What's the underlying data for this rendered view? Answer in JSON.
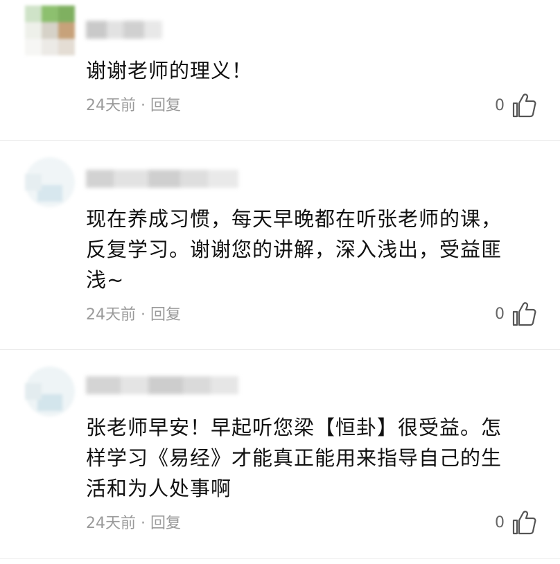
{
  "comments": [
    {
      "text": "谢谢老师的理义！",
      "time": "24天前",
      "separator": " · ",
      "reply_label": "回复",
      "likes": "0"
    },
    {
      "text": "现在养成习惯，每天早晚都在听张老师的课，\n反复学习。谢谢您的讲解，深入浅出，受益匪\n浅~",
      "time": "24天前",
      "separator": " · ",
      "reply_label": "回复",
      "likes": "0"
    },
    {
      "text": "张老师早安！早起听您梁【恒卦】很受益。怎\n样学习《易经》才能真正能用来指导自己的生\n活和为人处事啊",
      "time": "24天前",
      "separator": " · ",
      "reply_label": "回复",
      "likes": "0"
    }
  ],
  "colors": {
    "text": "#111111",
    "meta": "#9a9a9a",
    "divider": "#ececec"
  }
}
